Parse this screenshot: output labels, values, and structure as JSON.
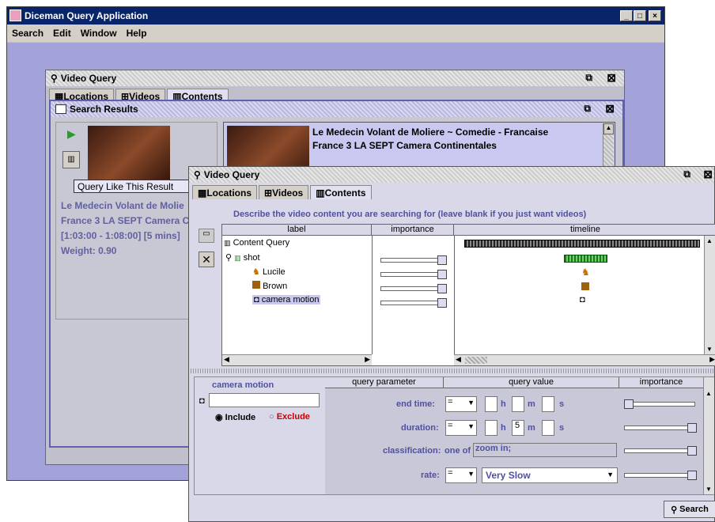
{
  "main_window": {
    "title": "Diceman Query Application",
    "menu": [
      "Search",
      "Edit",
      "Window",
      "Help"
    ]
  },
  "window_controls": {
    "minimize": "_",
    "maximize": "□",
    "close": "×"
  },
  "query_frame_back": {
    "title": "Video Query",
    "tabs": [
      "Locations",
      "Videos",
      "Contents"
    ]
  },
  "search_results": {
    "title": "Search Results",
    "tooltip": "Query Like This Result",
    "left_item": {
      "lines": [
        "Le Medecin Volant de Molie",
        "France 3 LA SEPT Camera C",
        "[1:03:00 - 1:08:00] [5 mins]",
        "Weight: 0.90"
      ]
    },
    "right_item": {
      "line1": "Le Medecin Volant de Moliere ~ Comedie - Francaise",
      "line2": "France 3 LA SEPT Camera Continentales"
    }
  },
  "query_frame_front": {
    "title": "Video Query",
    "tabs": [
      "Locations",
      "Videos",
      "Contents"
    ],
    "instruction": "Describe the video content you are searching for (leave blank if you just want videos)",
    "columns": [
      "label",
      "importance",
      "timeline"
    ],
    "tree": [
      {
        "label": "Content Query",
        "importance": null
      },
      {
        "label": "shot",
        "importance": 0.9
      },
      {
        "label": "Lucile",
        "importance": 0.9
      },
      {
        "label": "Brown",
        "importance": 0.9
      },
      {
        "label": "camera motion",
        "importance": 0.9
      }
    ],
    "detail": {
      "label_header": "camera motion",
      "include": "Include",
      "exclude": "Exclude",
      "columns": [
        "query parameter",
        "query value",
        "importance"
      ],
      "rows": [
        {
          "param": "end time:",
          "op": "=",
          "h": "",
          "m": "",
          "s": "",
          "importance": 0.0
        },
        {
          "param": "duration:",
          "op": "=",
          "h": "",
          "m": "5",
          "s": "",
          "importance": 0.95
        },
        {
          "param": "classification:",
          "prefix": "one of",
          "value": "zoom in;",
          "importance": 0.95
        },
        {
          "param": "rate:",
          "op": "=",
          "value": "Very Slow",
          "importance": 0.95
        }
      ],
      "unit_h": "h",
      "unit_m": "m",
      "unit_s": "s"
    },
    "search_button": "Search"
  }
}
